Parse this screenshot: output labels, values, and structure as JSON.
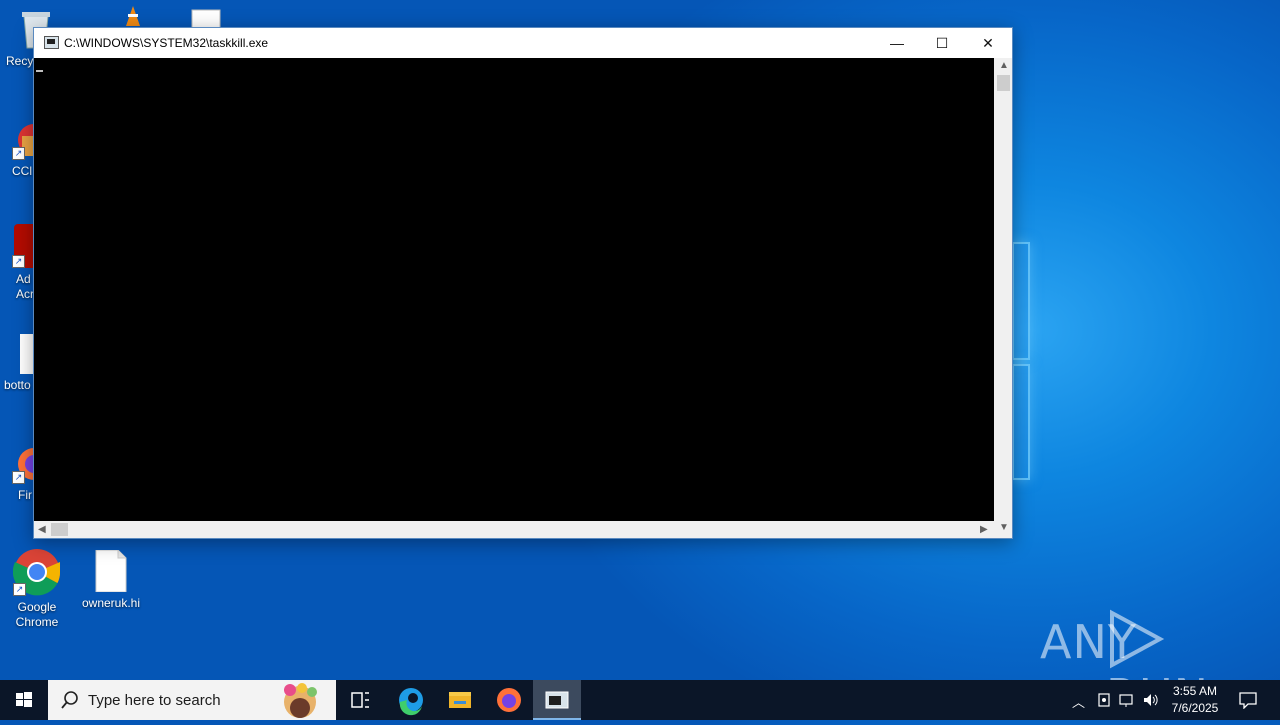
{
  "desktop": {
    "icons": [
      {
        "label": "Recy"
      },
      {
        "label": "CCl"
      },
      {
        "label": "Ad\nAcr"
      },
      {
        "label": "botto"
      },
      {
        "label": "Fir"
      },
      {
        "label": "Google\nChrome"
      },
      {
        "label": "owneruk.hi"
      }
    ]
  },
  "window": {
    "title": "C:\\WINDOWS\\SYSTEM32\\taskkill.exe",
    "minimize_glyph": "—",
    "maximize_glyph": "☐",
    "close_glyph": "✕"
  },
  "watermark": {
    "left": "ANY",
    "right": "RUN"
  },
  "taskbar": {
    "search_placeholder": "Type here to search",
    "clock_time": "3:55 AM",
    "clock_date": "7/6/2025",
    "icons": [
      "windows-start-icon",
      "search-icon",
      "task-view-icon",
      "edge-icon",
      "file-explorer-icon",
      "firefox-icon",
      "console-icon"
    ]
  }
}
